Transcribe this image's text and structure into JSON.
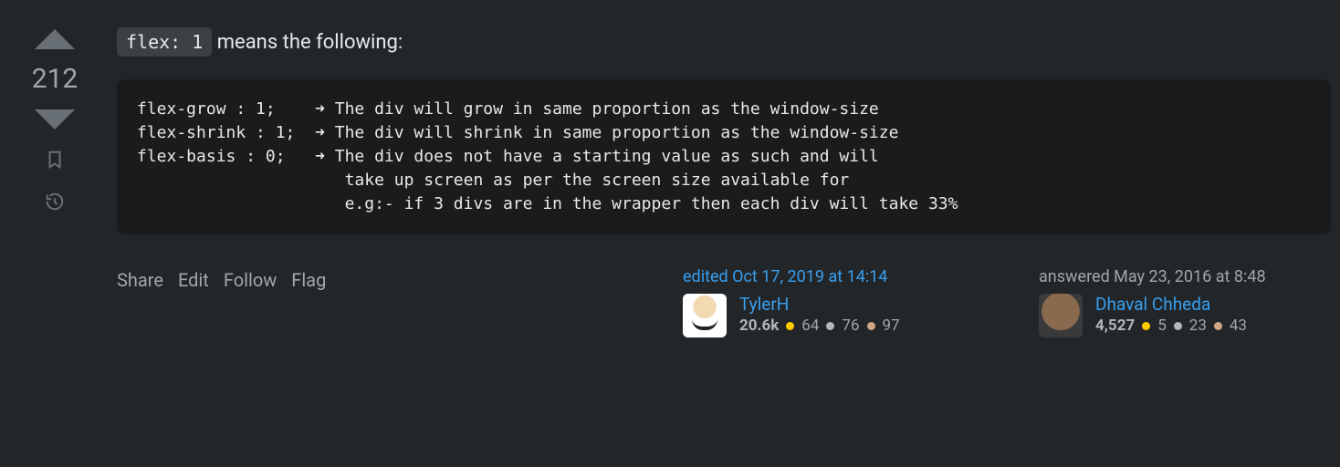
{
  "vote": {
    "count": "212"
  },
  "intro": {
    "code": "flex: 1",
    "text": " means the following:"
  },
  "code_block": "flex-grow : 1;    ➜ The div will grow in same proportion as the window-size\nflex-shrink : 1;  ➜ The div will shrink in same proportion as the window-size\nflex-basis : 0;   ➜ The div does not have a starting value as such and will\n                     take up screen as per the screen size available for\n                     e.g:- if 3 divs are in the wrapper then each div will take 33%",
  "actions": {
    "share": "Share",
    "edit": "Edit",
    "follow": "Follow",
    "flag": "Flag"
  },
  "editor": {
    "action_time": "edited Oct 17, 2019 at 14:14",
    "name": "TylerH",
    "reputation": "20.6k",
    "gold": "64",
    "silver": "76",
    "bronze": "97"
  },
  "author": {
    "action_time": "answered May 23, 2016 at 8:48",
    "name": "Dhaval Chheda",
    "reputation": "4,527",
    "gold": "5",
    "silver": "23",
    "bronze": "43"
  }
}
